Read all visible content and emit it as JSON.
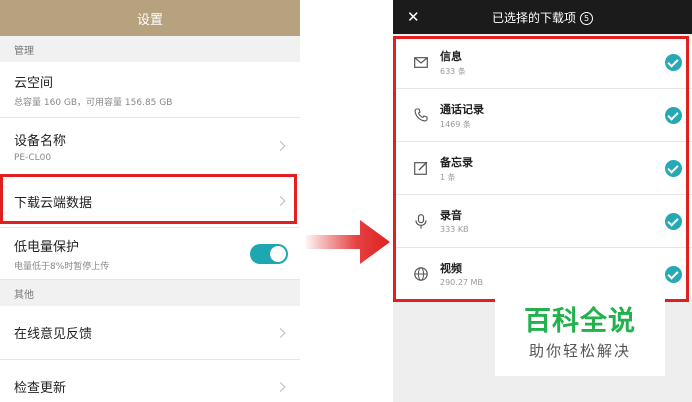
{
  "left": {
    "header_title": "设置",
    "section_manage": "管理",
    "cloud": {
      "title": "云空间",
      "subtitle": "总容量 160 GB，可用容量 156.85 GB"
    },
    "device_name": {
      "title": "设备名称",
      "subtitle": "PE-CL00"
    },
    "download_cloud": {
      "title": "下载云端数据"
    },
    "low_power": {
      "title": "低电量保护",
      "subtitle": "电量低于8%时暂停上传",
      "enabled": true
    },
    "section_other": "其他",
    "feedback": {
      "title": "在线意见反馈"
    },
    "check_update": {
      "title": "检查更新"
    }
  },
  "right": {
    "header_title": "已选择的下载项",
    "selected_count": "5",
    "items": [
      {
        "name": "信息",
        "size": "633 条",
        "icon": "envelope-icon",
        "checked": true
      },
      {
        "name": "通话记录",
        "size": "1469 条",
        "icon": "phone-icon",
        "checked": true
      },
      {
        "name": "备忘录",
        "size": "1 条",
        "icon": "memo-edit-icon",
        "checked": true
      },
      {
        "name": "录音",
        "size": "333 KB",
        "icon": "microphone-icon",
        "checked": true
      },
      {
        "name": "视频",
        "size": "290.27 MB",
        "icon": "video-globe-icon",
        "checked": true
      }
    ]
  },
  "watermark": {
    "big": "百科全说",
    "small": "助你轻松解决"
  },
  "colors": {
    "accent_teal": "#26a9b4",
    "header_gold": "#b6a27f",
    "highlight_red": "#e02020",
    "watermark_green": "#23b14d"
  }
}
